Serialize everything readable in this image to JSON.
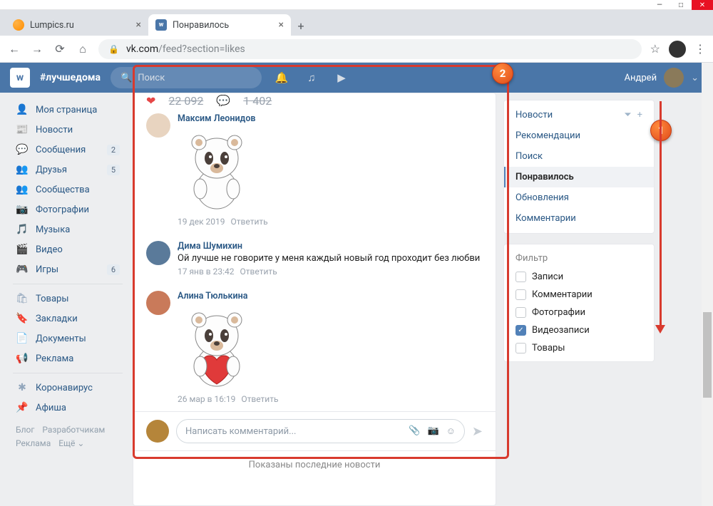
{
  "window": {
    "controls": {
      "min": "—",
      "max": "□",
      "close": "✕"
    }
  },
  "tabs": [
    {
      "label": "Lumpics.ru",
      "active": false
    },
    {
      "label": "Понравилось",
      "active": true
    }
  ],
  "address": {
    "host": "vk.com",
    "path": "/feed?section=likes"
  },
  "vkHeader": {
    "hashtag": "#лучшедома",
    "searchPlaceholder": "Поиск",
    "user": "Андрей"
  },
  "leftnav": [
    {
      "icon": "👤",
      "label": "Моя страница"
    },
    {
      "icon": "📰",
      "label": "Новости"
    },
    {
      "icon": "💬",
      "label": "Сообщения",
      "badge": "2"
    },
    {
      "icon": "👥",
      "label": "Друзья",
      "badge": "5"
    },
    {
      "icon": "👥",
      "label": "Сообщества"
    },
    {
      "icon": "📷",
      "label": "Фотографии"
    },
    {
      "icon": "🎵",
      "label": "Музыка"
    },
    {
      "icon": "🎬",
      "label": "Видео"
    },
    {
      "icon": "🎮",
      "label": "Игры",
      "badge": "6"
    }
  ],
  "leftnav2": [
    {
      "icon": "🛍",
      "label": "Товары"
    },
    {
      "icon": "🔖",
      "label": "Закладки"
    },
    {
      "icon": "📄",
      "label": "Документы"
    },
    {
      "icon": "📢",
      "label": "Реклама"
    }
  ],
  "leftnav3": [
    {
      "icon": "✱",
      "label": "Коронавирус"
    },
    {
      "icon": "📌",
      "label": "Афиша"
    }
  ],
  "footer": {
    "a": "Блог",
    "b": "Разработчикам",
    "c": "Реклама",
    "d": "Ещё ⌄"
  },
  "likes": {
    "count": "22 092",
    "comments": "1 402"
  },
  "comments": [
    {
      "name": "Максим Леонидов",
      "sticker": "sad",
      "date": "19 дек 2019",
      "reply": "Ответить"
    },
    {
      "name": "Дима Шумихин",
      "text": "Ой лучше не говорите у меня каждый новый год проходит без любви",
      "date": "17 янв в 23:42",
      "reply": "Ответить"
    },
    {
      "name": "Алина Тюлькина",
      "sticker": "heart",
      "date": "26 мар в 16:19",
      "reply": "Ответить"
    }
  ],
  "compose": {
    "placeholder": "Написать комментарий..."
  },
  "feedFooter": "Показаны последние новости",
  "rightTabs": [
    {
      "label": "Новости",
      "icons": true
    },
    {
      "label": "Рекомендации"
    },
    {
      "label": "Поиск"
    },
    {
      "label": "Понравилось",
      "active": true
    },
    {
      "label": "Обновления"
    },
    {
      "label": "Комментарии"
    }
  ],
  "filter": {
    "title": "Фильтр",
    "items": [
      {
        "label": "Записи",
        "checked": false
      },
      {
        "label": "Комментарии",
        "checked": false
      },
      {
        "label": "Фотографии",
        "checked": false
      },
      {
        "label": "Видеозаписи",
        "checked": true
      },
      {
        "label": "Товары",
        "checked": false
      }
    ]
  },
  "callouts": {
    "one": "1",
    "two": "2"
  }
}
